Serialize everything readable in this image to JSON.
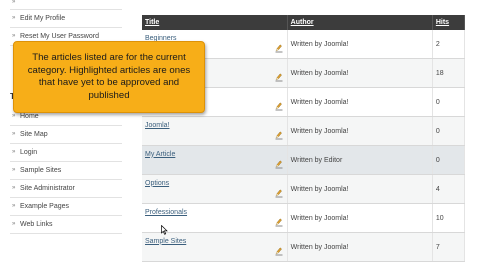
{
  "sidebar": {
    "top_items": [
      "",
      "Edit My Profile",
      "Reset My User Password"
    ],
    "heading_fragment": "T",
    "main_items": [
      "Home",
      "Site Map",
      "Login",
      "Sample Sites",
      "Site Administrator",
      "Example Pages",
      "Web Links"
    ]
  },
  "table": {
    "headers": {
      "title": "Title",
      "author": "Author",
      "hits": "Hits"
    },
    "rows": [
      {
        "title": "Beginners",
        "author": "Written by Joomla!",
        "hits": "2",
        "highlighted": false
      },
      {
        "title": "",
        "author": "Written by Joomla!",
        "hits": "18",
        "highlighted": false
      },
      {
        "title": "",
        "author": "Written by Joomla!",
        "hits": "0",
        "highlighted": false
      },
      {
        "title": "Joomla!",
        "author": "Written by Joomla!",
        "hits": "0",
        "highlighted": false
      },
      {
        "title": "My Article",
        "author": "Written by Editor",
        "hits": "0",
        "highlighted": true
      },
      {
        "title": "Options",
        "author": "Written by Joomla!",
        "hits": "4",
        "highlighted": false
      },
      {
        "title": "Professionals",
        "author": "Written by Joomla!",
        "hits": "10",
        "highlighted": false
      },
      {
        "title": "Sample Sites",
        "author": "Written by Joomla!",
        "hits": "7",
        "highlighted": false
      }
    ]
  },
  "callout": {
    "text": "The articles listed are for the current category. Highlighted articles are ones that have yet to be approved and published"
  },
  "colors": {
    "header_bg": "#3c3c3c",
    "callout_bg": "#f7ae18",
    "link": "#3b5f7d",
    "highlight_row": "#e3e7ea"
  },
  "icons": {
    "row_edit": "pencil-icon",
    "cursor": "mouse-pointer-icon"
  }
}
